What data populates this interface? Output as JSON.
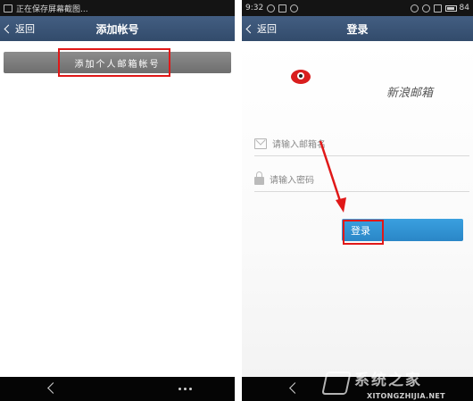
{
  "left": {
    "status": {
      "text": "正在保存屏幕截图..."
    },
    "header": {
      "back_label": "返回",
      "title": "添加帐号"
    },
    "add_button_label": "添加个人邮箱帐号"
  },
  "right": {
    "status": {
      "time": "9:32",
      "battery": "84"
    },
    "header": {
      "back_label": "返回",
      "title": "登录"
    },
    "logo_text": "新浪邮箱",
    "email_placeholder": "请输入邮箱名",
    "password_placeholder": "请输入密码",
    "login_button_label": "登录"
  },
  "watermark": {
    "cn": "系统之家",
    "url": "XITONGZHIJIA.NET"
  },
  "colors": {
    "header": "#3a5577",
    "highlight": "#e01818",
    "login": "#2f93d6",
    "nav": "#050505"
  }
}
